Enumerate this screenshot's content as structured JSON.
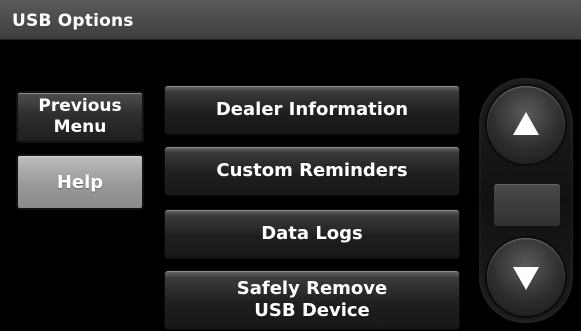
{
  "titlebar": {
    "title": "USB Options"
  },
  "left_buttons": {
    "previous_menu": {
      "line1": "Previous",
      "line2": "Menu"
    },
    "help": {
      "label": "Help"
    }
  },
  "menu": {
    "items": [
      {
        "line1": "Dealer Information",
        "line2": ""
      },
      {
        "line1": "Custom Reminders",
        "line2": ""
      },
      {
        "line1": "Data Logs",
        "line2": ""
      },
      {
        "line1": "Safely Remove",
        "line2": "USB Device"
      }
    ]
  },
  "scroll": {
    "up_icon": "up-arrow-icon",
    "down_icon": "down-arrow-icon"
  }
}
